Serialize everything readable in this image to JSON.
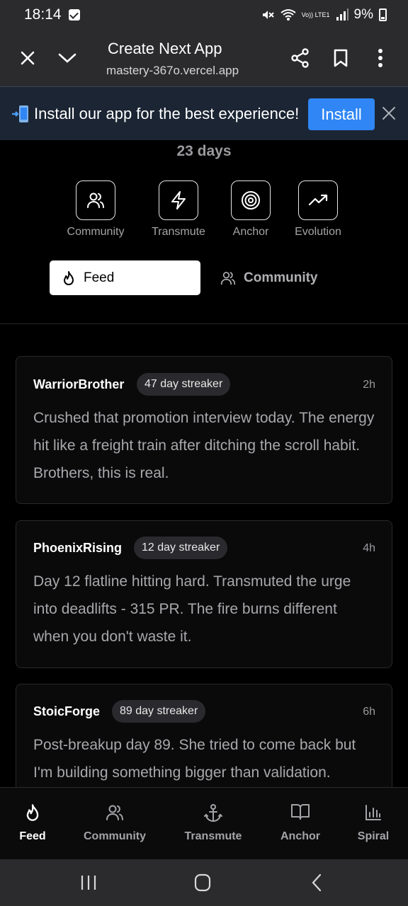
{
  "status_bar": {
    "time": "18:14",
    "battery": "9%",
    "network": "Vo)) LTE1"
  },
  "browser": {
    "title": "Create Next App",
    "url": "mastery-367o.vercel.app"
  },
  "install_banner": {
    "message": "Install our app for the best experience!",
    "button": "Install"
  },
  "streak": {
    "days": "23 days"
  },
  "quick_actions": [
    {
      "label": "Community",
      "icon": "users-icon"
    },
    {
      "label": "Transmute",
      "icon": "lightning-icon"
    },
    {
      "label": "Anchor",
      "icon": "target-icon"
    },
    {
      "label": "Evolution",
      "icon": "trending-up-icon"
    }
  ],
  "segments": {
    "feed": "Feed",
    "community": "Community"
  },
  "posts": [
    {
      "user": "WarriorBrother",
      "badge": "47 day streaker",
      "time": "2h",
      "body": "Crushed that promotion interview today. The energy hit like a freight train after ditching the scroll habit. Brothers, this is real."
    },
    {
      "user": "PhoenixRising",
      "badge": "12 day streaker",
      "time": "4h",
      "body": "Day 12 flatline hitting hard. Transmuted the urge into deadlifts - 315 PR. The fire burns different when you don't waste it."
    },
    {
      "user": "StoicForge",
      "badge": "89 day streaker",
      "time": "6h",
      "body": "Post-breakup day 89. She tried to come back but I'm building something bigger than validation."
    }
  ],
  "bottom_nav": [
    {
      "label": "Feed",
      "icon": "flame-icon",
      "active": true
    },
    {
      "label": "Community",
      "icon": "users-icon"
    },
    {
      "label": "Transmute",
      "icon": "anchor-icon"
    },
    {
      "label": "Anchor",
      "icon": "book-icon"
    },
    {
      "label": "Spiral",
      "icon": "bar-chart-icon"
    }
  ],
  "colors": {
    "accent": "#2f86f4",
    "background": "#000000",
    "card": "#0a0a0b"
  }
}
